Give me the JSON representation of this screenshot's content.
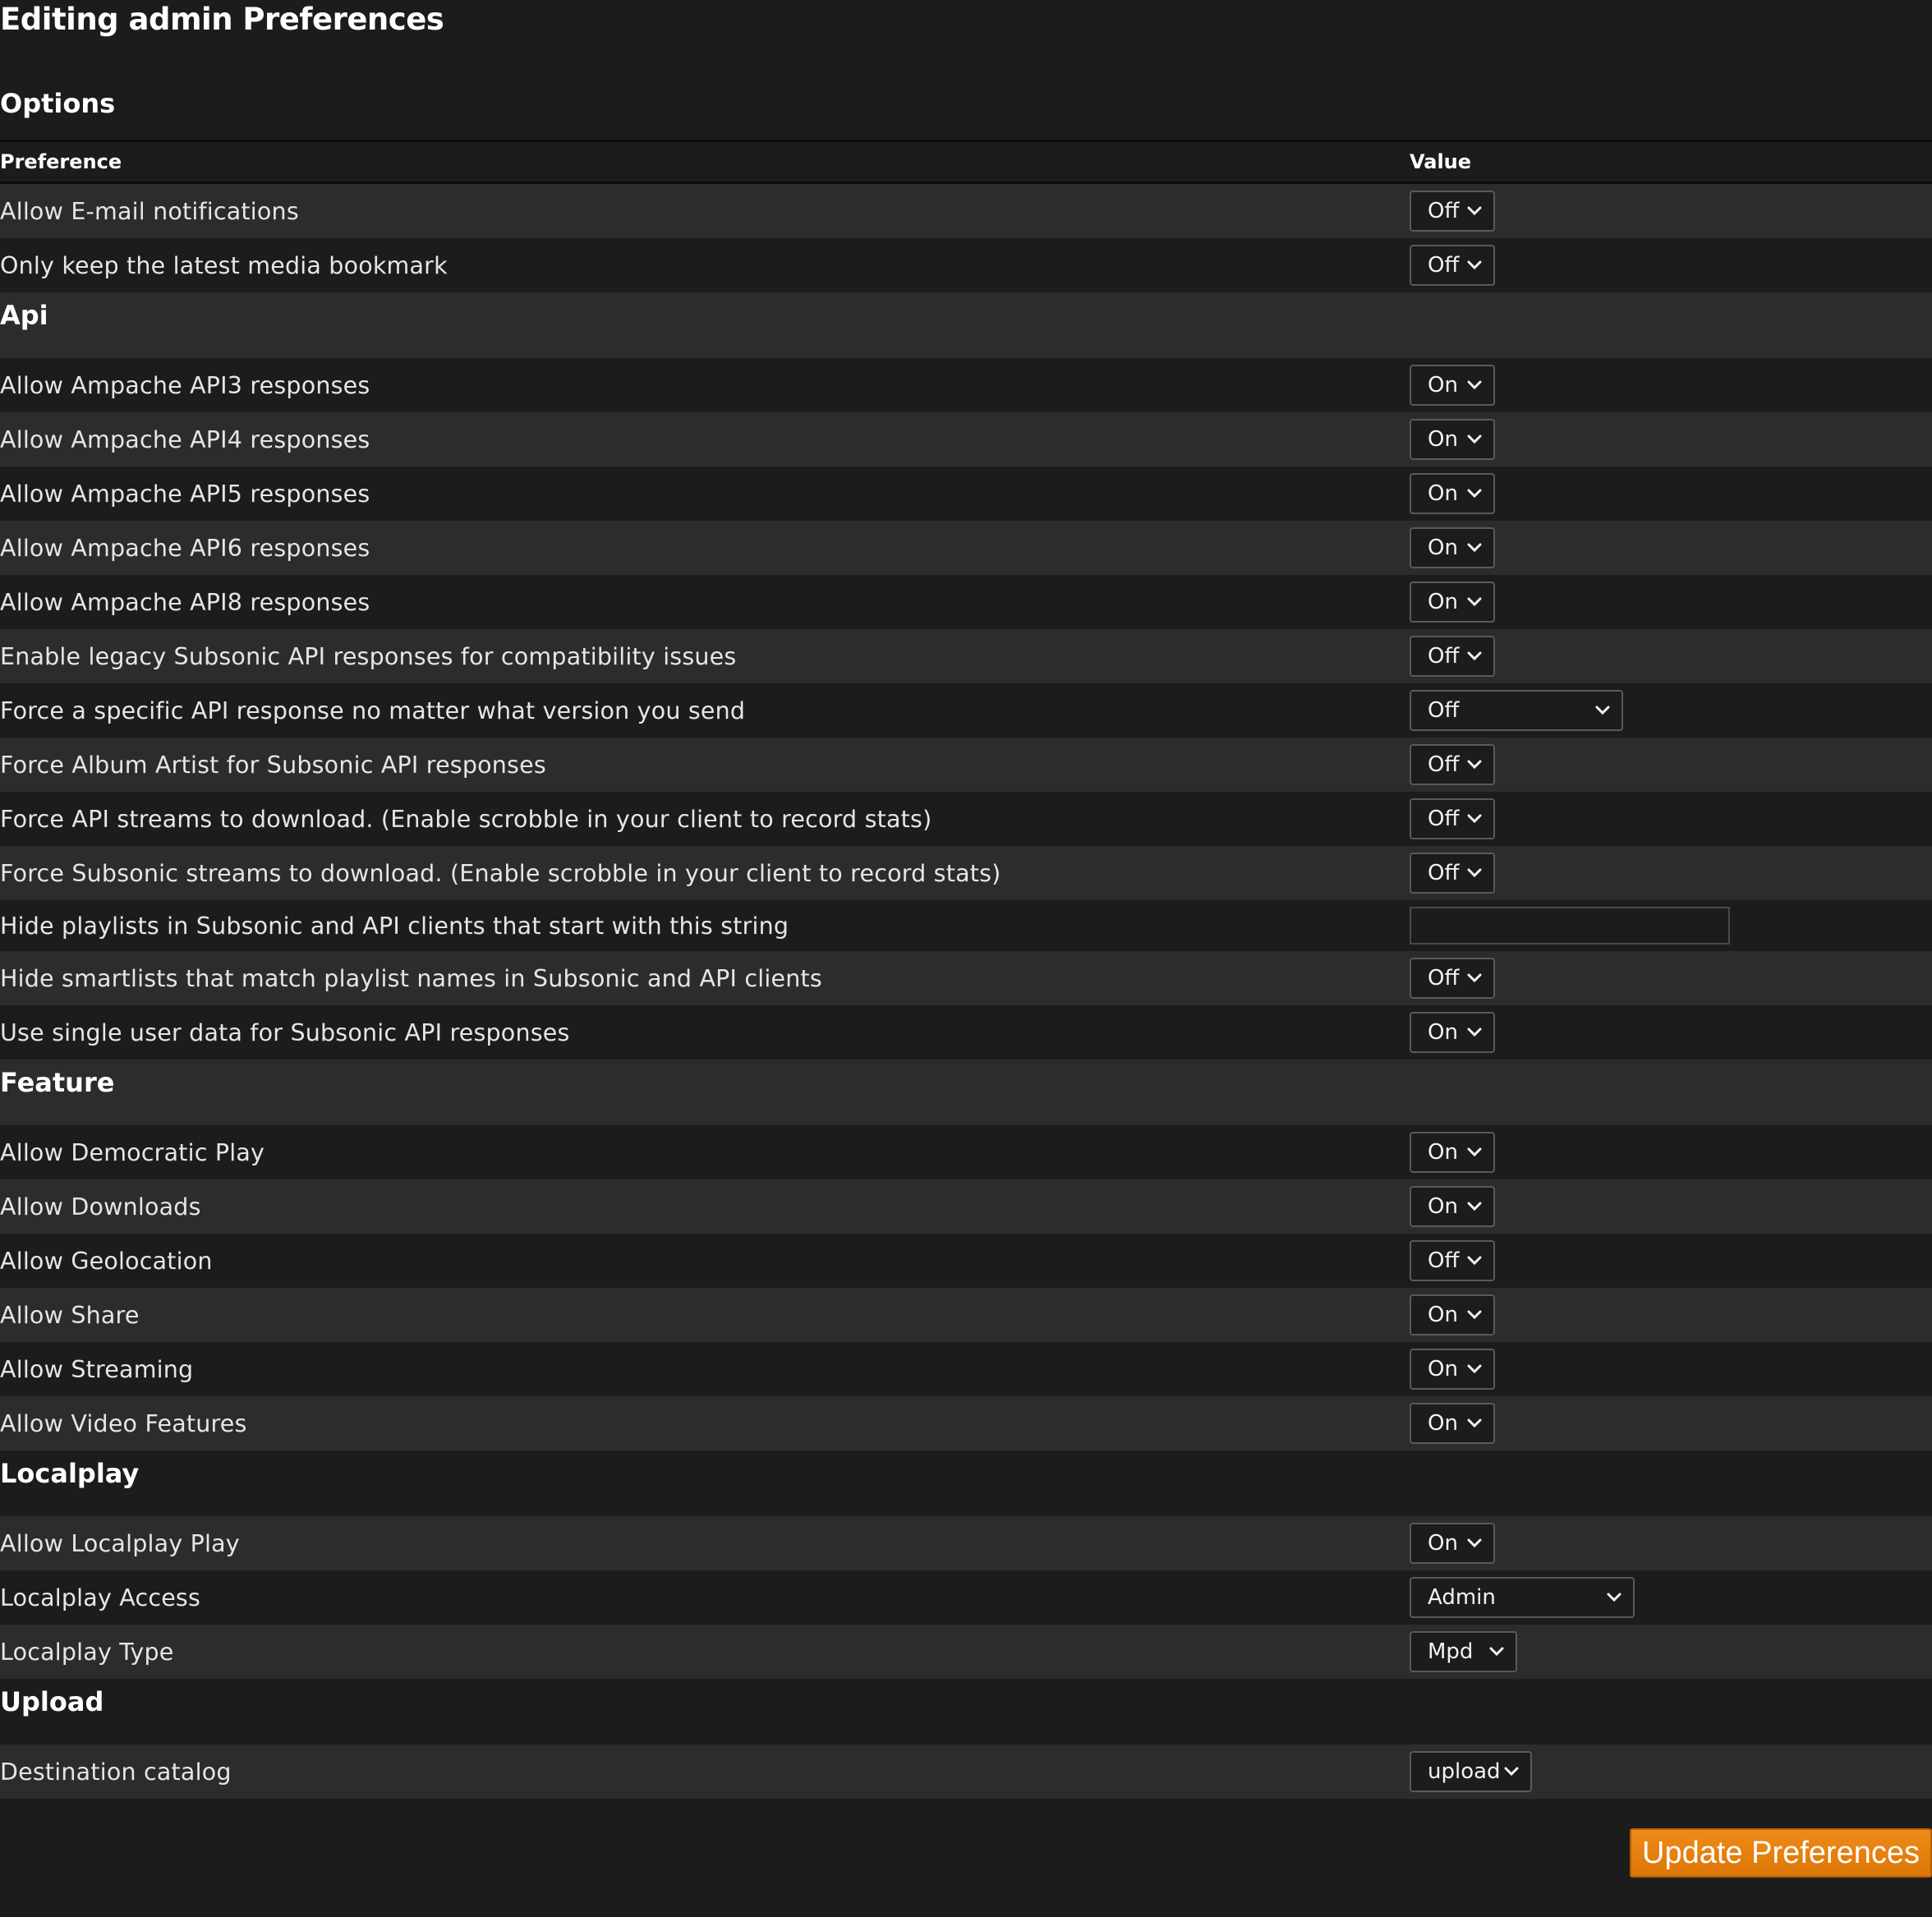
{
  "page_title": "Editing admin Preferences",
  "options_title": "Options",
  "table_header": {
    "preference": "Preference",
    "value": "Value"
  },
  "rows": [
    {
      "label": "Allow E-mail notifications",
      "value": "Off"
    },
    {
      "label": "Only keep the latest media bookmark",
      "value": "Off"
    }
  ],
  "sections": {
    "api": {
      "title": "Api",
      "rows": [
        {
          "label": "Allow Ampache API3 responses",
          "value": "On"
        },
        {
          "label": "Allow Ampache API4 responses",
          "value": "On"
        },
        {
          "label": "Allow Ampache API5 responses",
          "value": "On"
        },
        {
          "label": "Allow Ampache API6 responses",
          "value": "On"
        },
        {
          "label": "Allow Ampache API8 responses",
          "value": "On"
        },
        {
          "label": "Enable legacy Subsonic API responses for compatibility issues",
          "value": "Off"
        },
        {
          "label": "Force a specific API response no matter what version you send",
          "value": "Off"
        },
        {
          "label": "Force Album Artist for Subsonic API responses",
          "value": "Off"
        },
        {
          "label": "Force API streams to download. (Enable scrobble in your client to record stats)",
          "value": "Off"
        },
        {
          "label": "Force Subsonic streams to download. (Enable scrobble in your client to record stats)",
          "value": "Off"
        },
        {
          "label": "Hide playlists in Subsonic and API clients that start with this string",
          "value": ""
        },
        {
          "label": "Hide smartlists that match playlist names in Subsonic and API clients",
          "value": "Off"
        },
        {
          "label": "Use single user data for Subsonic API responses",
          "value": "On"
        }
      ]
    },
    "feature": {
      "title": "Feature",
      "rows": [
        {
          "label": "Allow Democratic Play",
          "value": "On"
        },
        {
          "label": "Allow Downloads",
          "value": "On"
        },
        {
          "label": "Allow Geolocation",
          "value": "Off"
        },
        {
          "label": "Allow Share",
          "value": "On"
        },
        {
          "label": "Allow Streaming",
          "value": "On"
        },
        {
          "label": "Allow Video Features",
          "value": "On"
        }
      ]
    },
    "localplay": {
      "title": "Localplay",
      "rows": [
        {
          "label": "Allow Localplay Play",
          "value": "On"
        },
        {
          "label": "Localplay Access",
          "value": "Admin"
        },
        {
          "label": "Localplay Type",
          "value": "Mpd"
        }
      ]
    },
    "upload": {
      "title": "Upload",
      "rows": [
        {
          "label": "Destination catalog",
          "value": "upload"
        }
      ]
    }
  },
  "submit_label": "Update Preferences",
  "colors": {
    "background": "#1c1c1c",
    "row_alt": "#2c2c2c",
    "accent": "#e8820d"
  }
}
